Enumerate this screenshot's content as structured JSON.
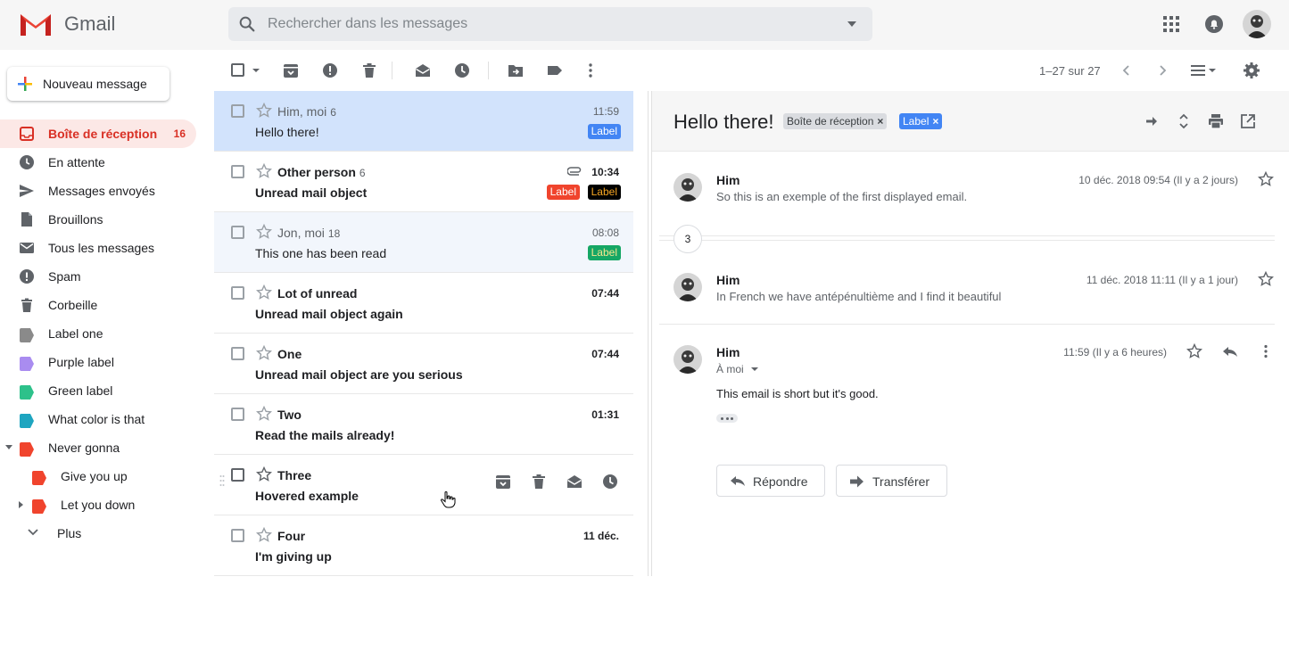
{
  "header": {
    "brand": "Gmail",
    "search_placeholder": "Rechercher dans les messages"
  },
  "sidebar": {
    "compose_label": "Nouveau message",
    "items": [
      {
        "label": "Boîte de réception",
        "count": "16"
      },
      {
        "label": "En attente"
      },
      {
        "label": "Messages envoyés"
      },
      {
        "label": "Brouillons"
      },
      {
        "label": "Tous les messages"
      },
      {
        "label": "Spam"
      },
      {
        "label": "Corbeille"
      },
      {
        "label": "Label one",
        "color": "#8a8a8a"
      },
      {
        "label": "Purple label",
        "color": "#a98cf0"
      },
      {
        "label": "Green label",
        "color": "#2dc18a"
      },
      {
        "label": "What color is that",
        "color": "#1ea5c0"
      },
      {
        "label": "Never gonna",
        "color": "#f0442d"
      },
      {
        "label": "Give you up",
        "color": "#f0442d"
      },
      {
        "label": "Let you down",
        "color": "#f0442d"
      },
      {
        "label": "Plus"
      }
    ]
  },
  "toolbar": {
    "pager": "1–27 sur 27"
  },
  "mails": [
    {
      "sender": "Him, moi",
      "count": "6",
      "subject": "Hello there!",
      "time": "11:59",
      "labels": [
        {
          "text": "Label",
          "bg": "#4285f4",
          "fg": "#ffffff"
        }
      ]
    },
    {
      "sender": "Other person",
      "count": "6",
      "subject": "Unread mail object",
      "time": "10:34",
      "labels": [
        {
          "text": "Label",
          "bg": "#f0442d",
          "fg": "#ffffff"
        },
        {
          "text": "Label",
          "bg": "#000000",
          "fg": "#f6a623"
        }
      ]
    },
    {
      "sender": "Jon, moi",
      "count": "18",
      "subject": "This one has been read",
      "time": "08:08",
      "labels": [
        {
          "text": "Label",
          "bg": "#16a765",
          "fg": "#f6e58d"
        }
      ]
    },
    {
      "sender": "Lot of unread",
      "count": "",
      "subject": "Unread mail object again",
      "time": "07:44",
      "labels": []
    },
    {
      "sender": "One",
      "count": "",
      "subject": "Unread mail object are you serious",
      "time": "07:44",
      "labels": []
    },
    {
      "sender": "Two",
      "count": "",
      "subject": "Read the mails already!",
      "time": "01:31",
      "labels": []
    },
    {
      "sender": "Three",
      "count": "",
      "subject": "Hovered example",
      "time": "",
      "labels": []
    },
    {
      "sender": "Four",
      "count": "",
      "subject": "I'm giving up",
      "time": "11 déc.",
      "labels": []
    }
  ],
  "pane": {
    "title": "Hello there!",
    "chips": [
      {
        "text": "Boîte de réception",
        "close": "×"
      },
      {
        "text": "Label",
        "close": "×"
      }
    ],
    "collapsed_count": "3",
    "messages": [
      {
        "from": "Him",
        "snippet": "So this is an exemple of the first displayed email.",
        "date": "10 déc. 2018 09:54 (Il y a 2 jours)"
      },
      {
        "from": "Him",
        "snippet": "In French we have antépénultième and I find it beautiful",
        "date": "11 déc. 2018 11:11 (Il y a 1 jour)"
      },
      {
        "from": "Him",
        "to": "À moi",
        "body": "This email is short but it's good.",
        "date": "11:59 (Il y a 6 heures)"
      }
    ],
    "reply_label": "Répondre",
    "forward_label": "Transférer"
  }
}
